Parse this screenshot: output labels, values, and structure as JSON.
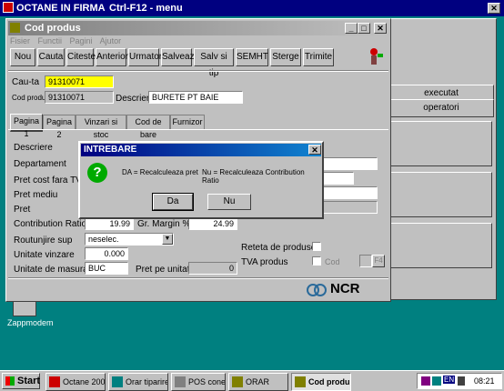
{
  "outer_window": {
    "title": "OCTANE IN FIRMA",
    "subtitle": "Ctrl-F12 - menu"
  },
  "desktop": {
    "icon_label": "Zappmodem",
    "side_buttons": [
      "executat",
      "operatori"
    ]
  },
  "form": {
    "title": "Cod produs",
    "menu": [
      "Fisier",
      "Functii",
      "Pagini",
      "Ajutor"
    ],
    "toolbar": [
      "Nou",
      "Cauta",
      "Citeste",
      "Anterior",
      "Urmator",
      "Salveaza",
      "Salv si tip",
      "SEMHT",
      "Sterge",
      "Trimite"
    ],
    "search_label": "Cau-ta",
    "search_value": "91310071",
    "code_label": "Cod produs",
    "code_value": "91310071",
    "description_label": "Descriere",
    "description_value": "BURETE PT BAIE",
    "tabs": [
      "Pagina 1",
      "Pagina 2",
      "Vinzari si stoc",
      "Cod de bare",
      "Furnizor"
    ],
    "fields": {
      "descriere": "Descriere",
      "departament": "Departament",
      "pret_cost": "Pret cost fara TVA",
      "pret_mediu": "Pret mediu",
      "pret": "Pret",
      "contribution_label": "Contribution Ratio %",
      "contribution_value": "19.99",
      "gr_margin_label": "Gr. Margin %",
      "gr_margin_value": "24.99",
      "rotunjire_label": "Routunjire sup",
      "rotunjire_value": "neselec.",
      "unitate_vinzare_label": "Unitate vinzare",
      "unitate_vinzare_value": "0.000",
      "unitate_masura_label": "Unitate de masura",
      "unitate_masura_value": "BUC",
      "pret_unitate_label": "Pret pe unitate",
      "pret_unitate_value": "0",
      "reteta_label": "Reteta de produse",
      "tva_label": "TVA produs",
      "cod_label": "Cod",
      "f4_label": "F4"
    },
    "logo_text": "NCR"
  },
  "dialog": {
    "title": "INTREBARE",
    "message_left": "DA = Recalculeaza pret",
    "message_right": "Nu = Recalculeaza Contribution Ratio",
    "yes_label": "Da",
    "no_label": "Nu"
  },
  "taskbar": {
    "start_label": "Start",
    "items": [
      "Octane 200...",
      "Orar tiparire",
      "POS conectat",
      "ORAR",
      "Cod produs"
    ],
    "clock": "08:21",
    "tray_lang": "EN"
  },
  "colors": {
    "desktop": "#008080",
    "active_title": "#000080",
    "inactive_title": "#808080",
    "highlight_field": "#ffff00"
  }
}
